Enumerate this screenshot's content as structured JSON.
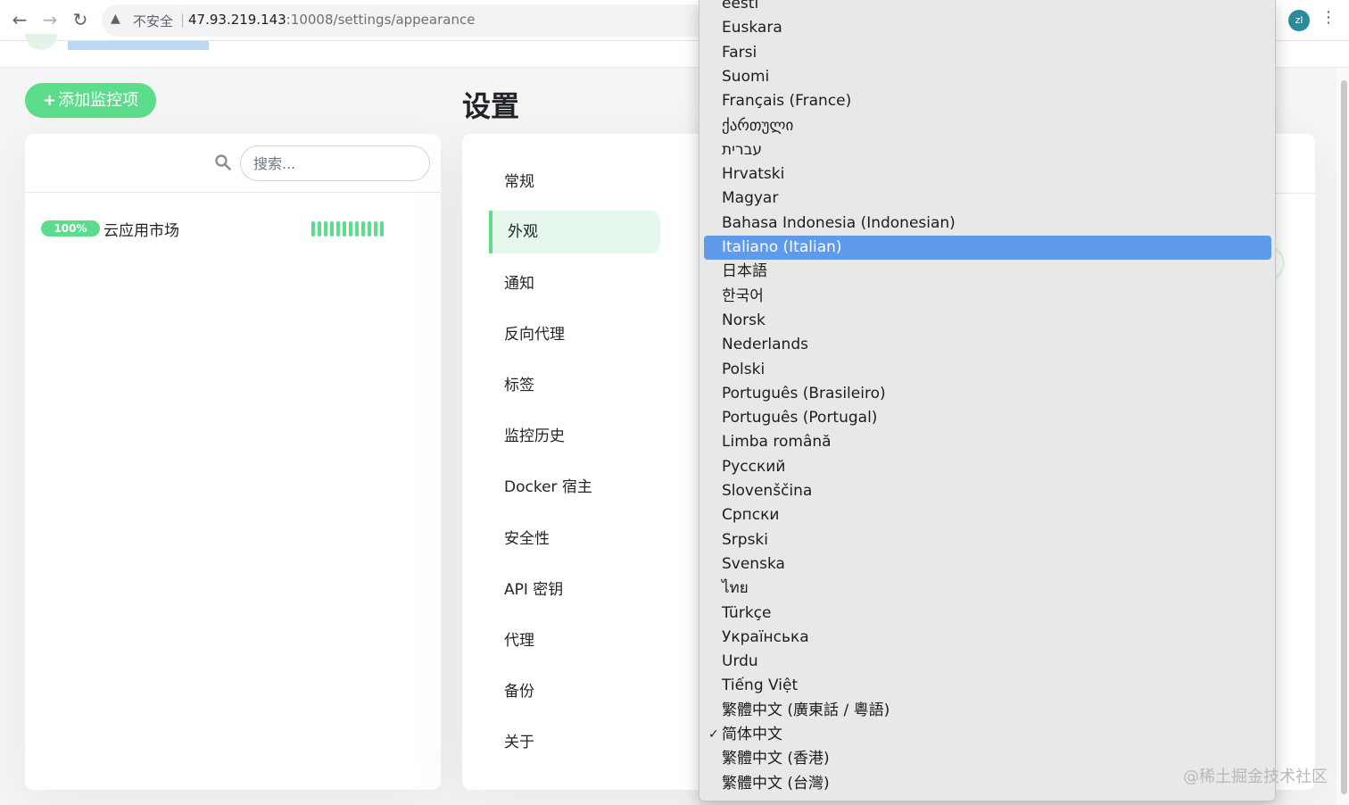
{
  "browser": {
    "back_icon": "←",
    "forward_icon": "→",
    "reload_icon": "↻",
    "warning_icon": "▲",
    "insecure_label": "不安全",
    "separator": "|",
    "url_host": "47.93.219.143",
    "url_rest": ":10008/settings/appearance",
    "profile_initials": "zl",
    "menu_icon": "⋮"
  },
  "sidebar": {
    "add_button_icon": "+",
    "add_button_label": "添加监控项",
    "search_placeholder": "搜索...",
    "monitors": [
      {
        "uptime": "100%",
        "name": "云应用市场",
        "beats_up": 12
      }
    ]
  },
  "settings": {
    "title": "设置",
    "menu": [
      {
        "label": "常规",
        "active": false
      },
      {
        "label": "外观",
        "active": true
      },
      {
        "label": "通知",
        "active": false
      },
      {
        "label": "反向代理",
        "active": false
      },
      {
        "label": "标签",
        "active": false
      },
      {
        "label": "监控历史",
        "active": false
      },
      {
        "label": "Docker 宿主",
        "active": false
      },
      {
        "label": "安全性",
        "active": false
      },
      {
        "label": "API 密钥",
        "active": false
      },
      {
        "label": "代理",
        "active": false
      },
      {
        "label": "备份",
        "active": false
      },
      {
        "label": "关于",
        "active": false
      }
    ]
  },
  "language_dropdown": {
    "highlighted": "Italiano (Italian)",
    "checked": "简体中文",
    "check_mark": "✓",
    "options": [
      "eesti",
      "Euskara",
      "Farsi",
      "Suomi",
      "Français (France)",
      "ქართული",
      "עברית",
      "Hrvatski",
      "Magyar",
      "Bahasa Indonesia (Indonesian)",
      "Italiano (Italian)",
      "日本語",
      "한국어",
      "Norsk",
      "Nederlands",
      "Polski",
      "Português (Brasileiro)",
      "Português (Portugal)",
      "Limba română",
      "Русский",
      "Slovenščina",
      "Српски",
      "Srpski",
      "Svenska",
      "ไทย",
      "Türkçe",
      "Українська",
      "Urdu",
      "Tiếng Việt",
      "繁體中文 (廣東話 / 粵語)",
      "简体中文",
      "繁體中文 (香港)",
      "繁體中文 (台灣)"
    ]
  },
  "watermark": "@稀土掘金技术社区",
  "colors": {
    "accent_green": "#5cdd8b",
    "active_menu_bg": "#e6f8ec",
    "dropdown_highlight": "#5f9bea",
    "dropdown_bg": "#e8e8e8"
  }
}
